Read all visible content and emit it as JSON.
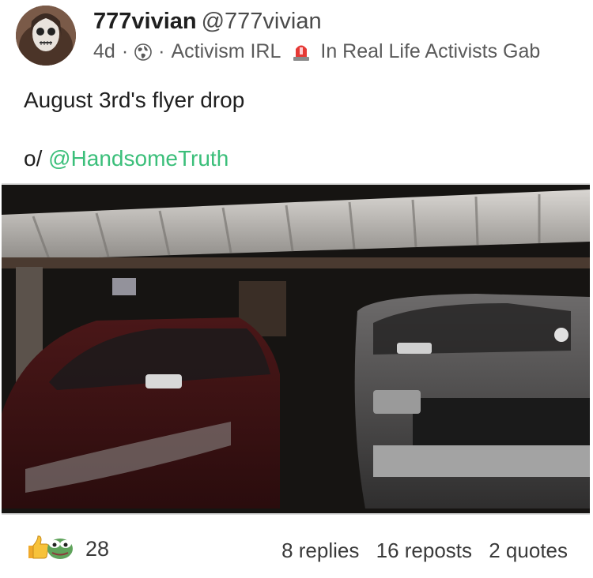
{
  "author": {
    "display_name": "777vivian",
    "handle": "@777vivian"
  },
  "meta": {
    "age": "4d",
    "dot": "·",
    "visibility_icon": "globe-icon",
    "group_name": "Activism IRL",
    "group_icon": "siren-icon",
    "group_full": "In Real Life Activists Gab"
  },
  "post": {
    "text": "August 3rd's flyer drop",
    "prefix": "o/ ",
    "mention": "@HandsomeTruth",
    "media_type": "video"
  },
  "footer": {
    "reaction_icons": [
      "thumbs-up-icon",
      "pepe-frog-icon"
    ],
    "reaction_count": "28",
    "replies": "8 replies",
    "reposts": "16 reposts",
    "quotes": "2 quotes"
  },
  "colors": {
    "mention": "#3bbf7a",
    "text": "#1f1f1f",
    "muted": "#5a5a5a"
  }
}
